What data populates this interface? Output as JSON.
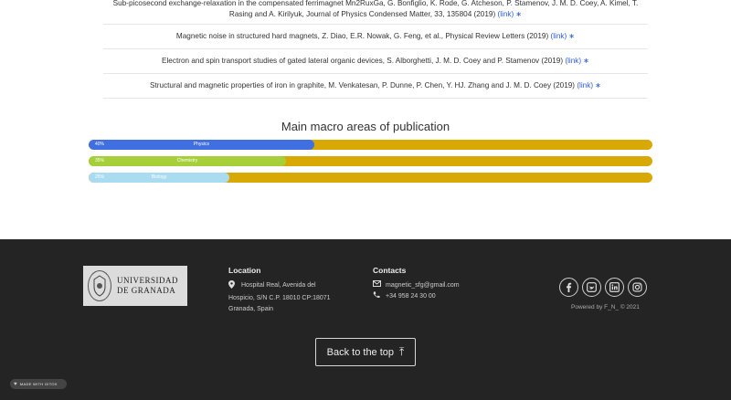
{
  "publications": [
    {
      "text": "Sub-picosecond exchange-relaxation in the compensated ferrimagnet Mn2RuxGa, G. Bonfiglio, K. Rode, G. Atcheson, P. Stamenov, J. M. D. Coey, A. Kimel, T. Rasing and A. Kirilyuk, Journal of Physics Condensed Matter, 33, 135804 (2019)",
      "link": "(link)",
      "star": "∗"
    },
    {
      "text": "Magnetic noise in structured hard magnets, Z. Diao, E.R. Nowak, G. Feng, et al., Physical Review Letters (2019)",
      "link": "(link)",
      "star": "∗"
    },
    {
      "text": "Electron and spin transport studies of gated lateral organic devices, S. Alborghetti, J. M. D. Coey and P. Stamenov (2019)",
      "link": "(link)",
      "star": "∗"
    },
    {
      "text": "Structural and magnetic properties of iron in graphite, M. Venkatesan, P. Dunne, P. Chen, Y. HJ. Zhang and J. M. D. Coey (2019)",
      "link": "(link)",
      "star": "∗"
    }
  ],
  "macro": {
    "title": "Main macro areas of publication",
    "areas": [
      {
        "name": "Physics",
        "percent_label": "40%",
        "value": 40,
        "color": "#3f6fe0"
      },
      {
        "name": "Chemistry",
        "percent_label": "35%",
        "value": 35,
        "color": "#a6cf3a"
      },
      {
        "name": "Biology",
        "percent_label": "25%",
        "value": 25,
        "color": "#a9dcf0"
      }
    ],
    "track_color": "#d8a805"
  },
  "footer": {
    "logo_line1": "UNIVERSIDAD",
    "logo_line2": "DE GRANADA",
    "location_title": "Location",
    "address_line1": "Hospital Real, Avenida del",
    "address_line2": "Hospicio, S/N C.P. 18010 CP:18071",
    "address_line3": "Granada, Spain",
    "contacts_title": "Contacts",
    "email": "magnetic_sfg@gmail.com",
    "phone": "+34 958 24 30 00",
    "powered": "Powered by F_N_ © 2021",
    "back_to_top": "Back to the top",
    "back_arrow": "⤒",
    "gitox_badge": "MADE WITH GITOX",
    "socials": [
      "facebook-icon",
      "twitter-icon",
      "linkedin-icon",
      "instagram-icon"
    ]
  }
}
